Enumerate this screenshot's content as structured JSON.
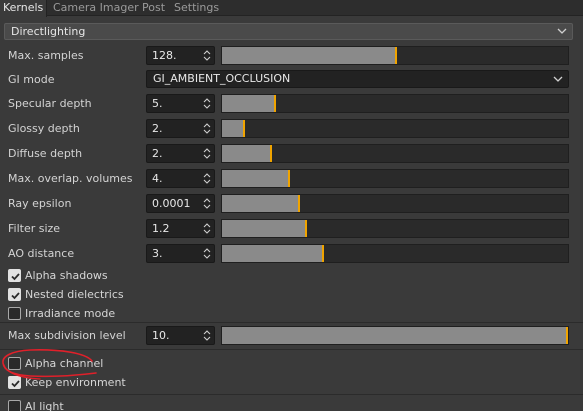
{
  "tabs": [
    {
      "label": "Kernels",
      "active": true
    },
    {
      "label": "Camera Imager",
      "active": false
    },
    {
      "label": "Post",
      "active": false
    },
    {
      "label": "Settings",
      "active": false
    }
  ],
  "section_select": {
    "value": "Directlighting"
  },
  "max_samples": {
    "label": "Max. samples",
    "value": "128.",
    "fill": 0.5
  },
  "gi_mode": {
    "label": "GI mode",
    "value": "GI_AMBIENT_OCCLUSION"
  },
  "specular_depth": {
    "label": "Specular depth",
    "value": "5.",
    "fill": 0.15
  },
  "glossy_depth": {
    "label": "Glossy depth",
    "value": "2.",
    "fill": 0.06
  },
  "diffuse_depth": {
    "label": "Diffuse depth",
    "value": "2.",
    "fill": 0.14
  },
  "max_overlap_volumes": {
    "label": "Max. overlap. volumes",
    "value": "4.",
    "fill": 0.19
  },
  "ray_epsilon": {
    "label": "Ray epsilon",
    "value": "0.0001",
    "fill": 0.22
  },
  "filter_size": {
    "label": "Filter size",
    "value": "1.2",
    "fill": 0.24
  },
  "ao_distance": {
    "label": "AO distance",
    "value": "3.",
    "fill": 0.29
  },
  "checks_1": [
    {
      "label": "Alpha shadows",
      "checked": true
    },
    {
      "label": "Nested dielectrics",
      "checked": true
    },
    {
      "label": "Irradiance mode",
      "checked": false
    }
  ],
  "max_subdivision": {
    "label": "Max subdivision level",
    "value": "10.",
    "fill": 1.0
  },
  "checks_2": [
    {
      "label": "Alpha channel",
      "checked": false
    },
    {
      "label": "Keep environment",
      "checked": true
    },
    {
      "label": "AI light",
      "checked": false
    }
  ],
  "colors": {
    "accent": "#f0a400",
    "annotation": "#e0202a"
  }
}
